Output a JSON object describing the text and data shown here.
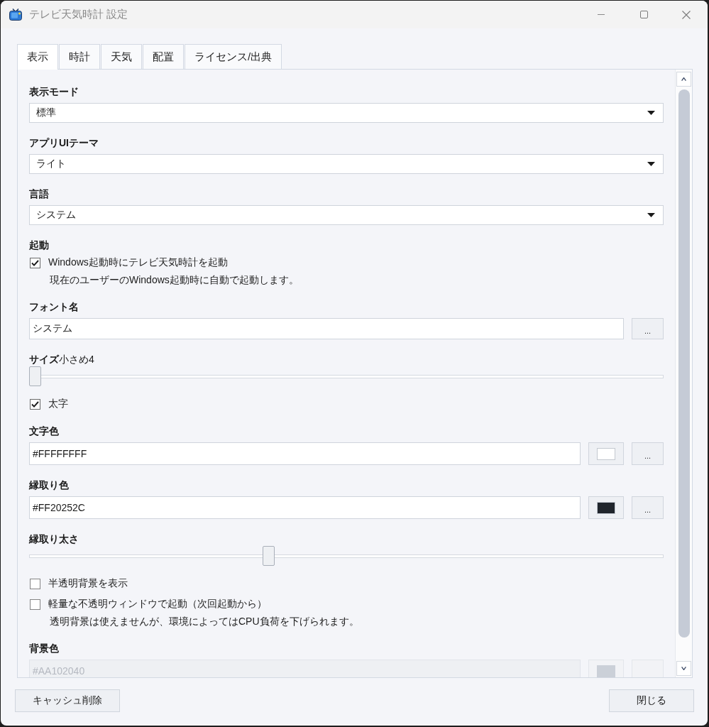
{
  "window": {
    "title": "テレビ天気時計 設定"
  },
  "tabs": [
    {
      "label": "表示",
      "selected": true
    },
    {
      "label": "時計",
      "selected": false
    },
    {
      "label": "天気",
      "selected": false
    },
    {
      "label": "配置",
      "selected": false
    },
    {
      "label": "ライセンス/出典",
      "selected": false
    }
  ],
  "settings": [
    {
      "kind": "select",
      "label": "表示モード",
      "value": "標準"
    },
    {
      "kind": "select",
      "label": "アプリUIテーマ",
      "value": "ライト"
    },
    {
      "kind": "select",
      "label": "言語",
      "value": "システム"
    },
    {
      "kind": "heading",
      "label": "起動"
    },
    {
      "kind": "checkbox",
      "label": "Windows起動時にテレビ天気時計を起動",
      "checked": true,
      "description": "現在のユーザーのWindows起動時に自動で起動します。"
    },
    {
      "kind": "text",
      "label": "フォント名",
      "value": "システム",
      "button": "..."
    },
    {
      "kind": "slider",
      "label": "サイズ",
      "reading": "小さめ4",
      "level": 0
    },
    {
      "kind": "checkbox",
      "label": "太字",
      "checked": true
    },
    {
      "kind": "color",
      "label": "文字色",
      "value": "#FFFFFFFF",
      "color": "#ffffff",
      "button": "...",
      "disabled": false
    },
    {
      "kind": "color",
      "label": "縁取り色",
      "value": "#FF20252C",
      "color": "#20252c",
      "button": "...",
      "disabled": false
    },
    {
      "kind": "slider",
      "label": "縁取り太さ",
      "level": 0.375
    },
    {
      "kind": "checkbox",
      "label": "半透明背景を表示",
      "checked": false
    },
    {
      "kind": "checkbox",
      "label": "軽量な不透明ウィンドウで起動（次回起動から）",
      "checked": false,
      "description": "透明背景は使えませんが、環境によってはCPU負荷を下げられます。"
    },
    {
      "kind": "color",
      "label": "背景色",
      "value": "#AA102040",
      "color": "#cbd0d8",
      "disabled": true
    }
  ],
  "buttons": [
    {
      "label": "キャッシュ削除"
    },
    {
      "label": "閉じる"
    }
  ]
}
